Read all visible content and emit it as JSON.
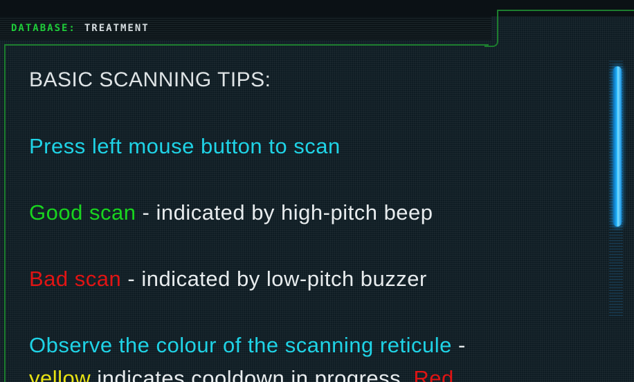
{
  "header": {
    "prefix": "DATABASE:",
    "title": "TREATMENT"
  },
  "content": {
    "heading": "BASIC SCANNING TIPS:",
    "tip1": "Press left mouse button to scan",
    "tip2": {
      "highlight": "Good scan",
      "text": " - indicated by high-pitch beep"
    },
    "tip3": {
      "highlight": "Bad scan",
      "text": " - indicated by low-pitch buzzer"
    },
    "tip4": {
      "line1": "Observe the colour of the scanning reticule",
      "line1_tail": " -",
      "yellow_word": "yellow",
      "line2_text": " indicates cooldown in progress. ",
      "red_word": "Red"
    }
  },
  "colors": {
    "good": "#19d41f",
    "bad": "#e01414",
    "info": "#1fd3e6",
    "cooldown": "#e8e214",
    "frame": "#1c7d2e",
    "scroll_thumb": "#23b6ff"
  }
}
